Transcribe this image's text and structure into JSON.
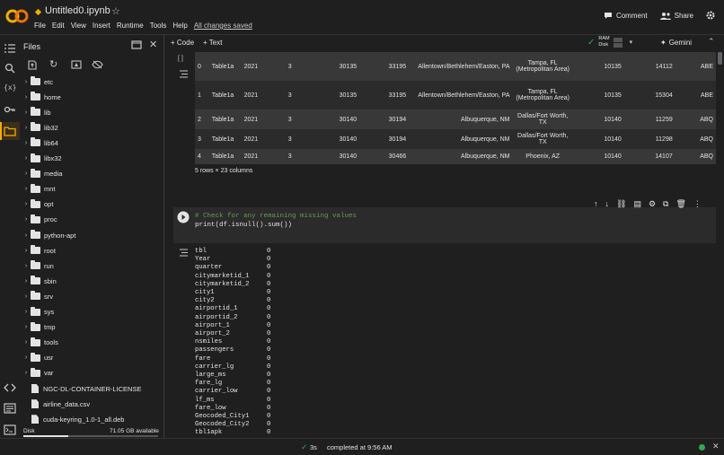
{
  "header": {
    "title": "Untitled0.ipynb",
    "menu": [
      "File",
      "Edit",
      "View",
      "Insert",
      "Runtime",
      "Tools",
      "Help"
    ],
    "saved": "All changes saved",
    "comment_label": "Comment",
    "share_label": "Share"
  },
  "toolbar": {
    "code_label": "+ Code",
    "text_label": "+ Text",
    "ram_label": "RAM",
    "disk_label": "Disk",
    "gemini_label": "Gemini"
  },
  "files": {
    "title": "Files",
    "folders": [
      "etc",
      "home",
      "lib",
      "lib32",
      "lib64",
      "libx32",
      "media",
      "mnt",
      "opt",
      "proc",
      "python-apt",
      "root",
      "run",
      "sbin",
      "srv",
      "sys",
      "tmp",
      "tools",
      "usr",
      "var"
    ],
    "files": [
      "NGC-DL-CONTAINER-LICENSE",
      "airline_data.csv",
      "cuda-keyring_1.0-1_all.deb"
    ],
    "disk_label": "Disk",
    "disk_available": "71.05 GB available",
    "disk_used_fraction": 0.33
  },
  "dataframe": {
    "bracket": "[ ]",
    "rows": [
      [
        "0",
        "Table1a",
        "2021",
        "3",
        "30135",
        "33195",
        "Allentown/Bethlehem/Easton, PA",
        "Tampa, FL (Metropolitan Area)",
        "10135",
        "14112",
        "ABE"
      ],
      [
        "1",
        "Table1a",
        "2021",
        "3",
        "30135",
        "33195",
        "Allentown/Bethlehem/Easton, PA",
        "Tampa, FL (Metropolitan Area)",
        "10135",
        "15304",
        "ABE"
      ],
      [
        "2",
        "Table1a",
        "2021",
        "3",
        "30140",
        "30194",
        "Albuquerque, NM",
        "Dallas/Fort Worth, TX",
        "10140",
        "11259",
        "ABQ"
      ],
      [
        "3",
        "Table1a",
        "2021",
        "3",
        "30140",
        "30194",
        "Albuquerque, NM",
        "Dallas/Fort Worth, TX",
        "10140",
        "11298",
        "ABQ"
      ],
      [
        "4",
        "Table1a",
        "2021",
        "3",
        "30140",
        "30466",
        "Albuquerque, NM",
        "Phoenix, AZ",
        "10140",
        "14107",
        "ABQ"
      ]
    ],
    "summary": "5 rows × 23 columns"
  },
  "code_cell": {
    "comment": "# Check for any remaining missing values",
    "code": "print(df.isnull().sum())"
  },
  "output": [
    [
      "tbl",
      "0"
    ],
    [
      "Year",
      "0"
    ],
    [
      "quarter",
      "0"
    ],
    [
      "citymarketid_1",
      "0"
    ],
    [
      "citymarketid_2",
      "0"
    ],
    [
      "city1",
      "0"
    ],
    [
      "city2",
      "0"
    ],
    [
      "airportid_1",
      "0"
    ],
    [
      "airportid_2",
      "0"
    ],
    [
      "airport_1",
      "0"
    ],
    [
      "airport_2",
      "0"
    ],
    [
      "nsmiles",
      "0"
    ],
    [
      "passengers",
      "0"
    ],
    [
      "fare",
      "0"
    ],
    [
      "carrier_lg",
      "0"
    ],
    [
      "large_ms",
      "0"
    ],
    [
      "fare_lg",
      "0"
    ],
    [
      "carrier_low",
      "0"
    ],
    [
      "lf_ms",
      "0"
    ],
    [
      "fare_low",
      "0"
    ],
    [
      "Geocoded_City1",
      "0"
    ],
    [
      "Geocoded_City2",
      "0"
    ],
    [
      "tbl1apk",
      "0"
    ]
  ],
  "status": {
    "duration": "3s",
    "completed": "completed at 9:56 AM"
  },
  "colors": {
    "accent": "#f9ab00",
    "ok": "#34a853"
  }
}
